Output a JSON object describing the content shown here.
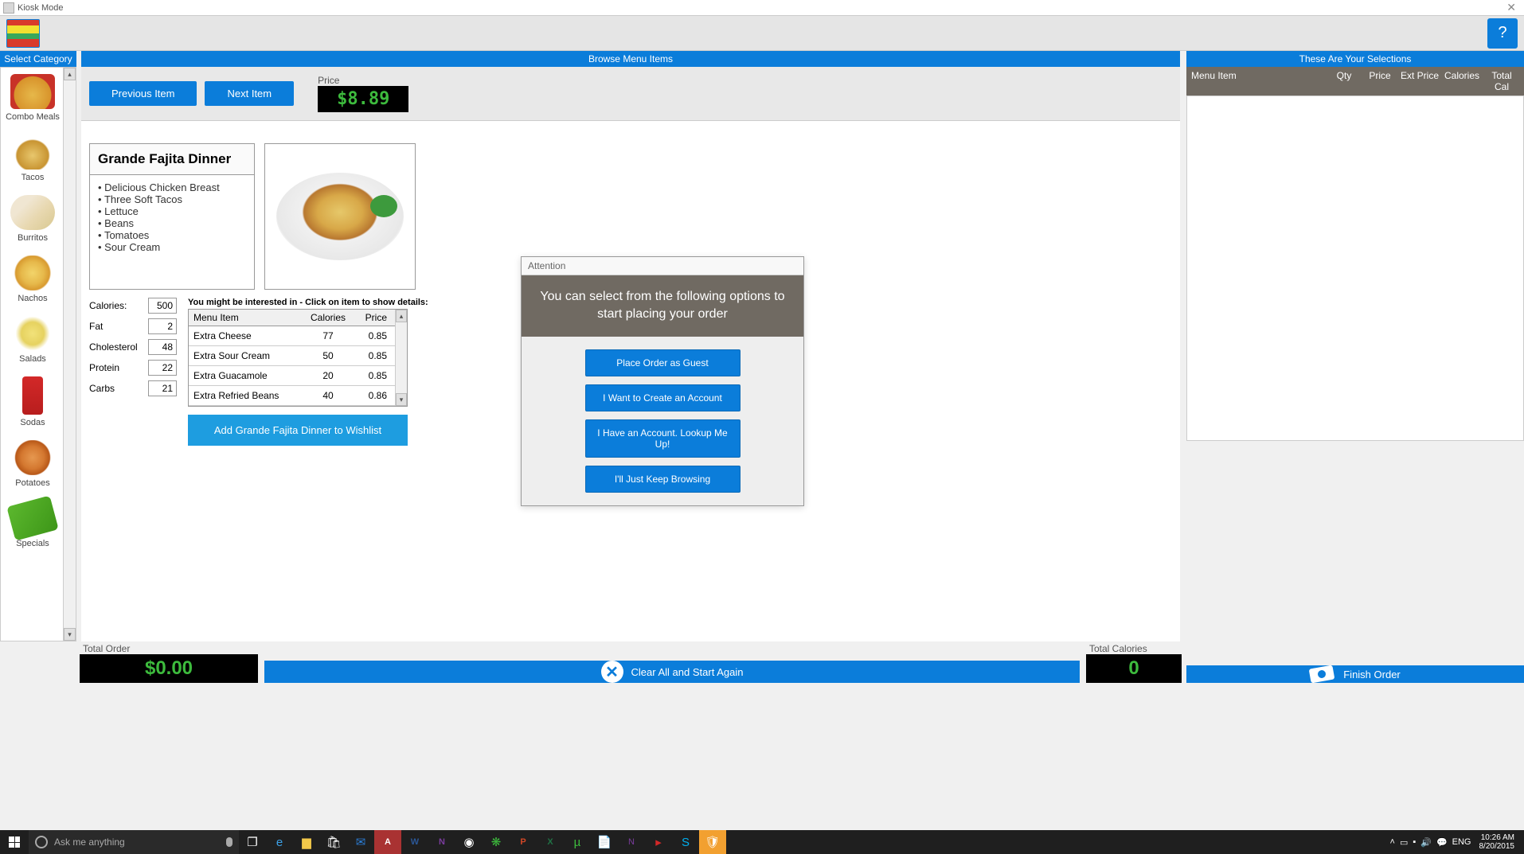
{
  "window": {
    "title": "Kiosk Mode"
  },
  "sidebar": {
    "header": "Select Category",
    "items": [
      {
        "label": "Combo Meals",
        "icon": "ic-combo"
      },
      {
        "label": "Tacos",
        "icon": "ic-tacos"
      },
      {
        "label": "Burritos",
        "icon": "ic-burritos"
      },
      {
        "label": "Nachos",
        "icon": "ic-nachos"
      },
      {
        "label": "Salads",
        "icon": "ic-salads"
      },
      {
        "label": "Sodas",
        "icon": "ic-sodas"
      },
      {
        "label": "Potatoes",
        "icon": "ic-potatoes"
      },
      {
        "label": "Specials",
        "icon": "ic-specials"
      }
    ]
  },
  "browse": {
    "header": "Browse Menu Items",
    "prev": "Previous Item",
    "next": "Next Item",
    "price_label": "Price",
    "price": "$8.89",
    "item_name": "Grande Fajita Dinner",
    "bullets": [
      "Delicious Chicken Breast",
      "Three Soft Tacos",
      "Lettuce",
      "Beans",
      "Tomatoes",
      "Sour Cream"
    ],
    "nutrition_labels": {
      "cal": "Calories:",
      "fat": "Fat",
      "chol": "Cholesterol",
      "prot": "Protein",
      "carbs": "Carbs"
    },
    "nutrition": {
      "cal": "500",
      "fat": "2",
      "chol": "48",
      "prot": "22",
      "carbs": "21"
    },
    "addon_hint": "You might be interested in - Click on item to show details:",
    "addon_headers": {
      "item": "Menu Item",
      "cal": "Calories",
      "price": "Price"
    },
    "addons": [
      {
        "name": "Extra Cheese",
        "cal": "77",
        "price": "0.85"
      },
      {
        "name": "Extra Sour Cream",
        "cal": "50",
        "price": "0.85"
      },
      {
        "name": "Extra Guacamole",
        "cal": "20",
        "price": "0.85"
      },
      {
        "name": "Extra Refried Beans",
        "cal": "40",
        "price": "0.86"
      }
    ],
    "wishlist": "Add Grande Fajita Dinner to Wishlist"
  },
  "modal": {
    "title": "Attention",
    "message": "You can select from the following options to start placing your order",
    "buttons": [
      "Place Order as Guest",
      "I Want to Create an Account",
      "I Have an Account. Lookup Me Up!",
      "I'll Just Keep Browsing"
    ]
  },
  "selections": {
    "header": "These Are Your Selections",
    "cols": {
      "item": "Menu Item",
      "qty": "Qty",
      "price": "Price",
      "ext": "Ext Price",
      "cal": "Calories",
      "totcal": "Total Cal"
    }
  },
  "totals": {
    "order_label": "Total Order",
    "order_value": "$0.00",
    "cal_label": "Total Calories",
    "cal_value": "0",
    "clear": "Clear All and Start Again",
    "finish": "Finish Order"
  },
  "taskbar": {
    "search_placeholder": "Ask me anything",
    "lang": "ENG",
    "time": "10:26 AM",
    "date": "8/20/2015"
  }
}
